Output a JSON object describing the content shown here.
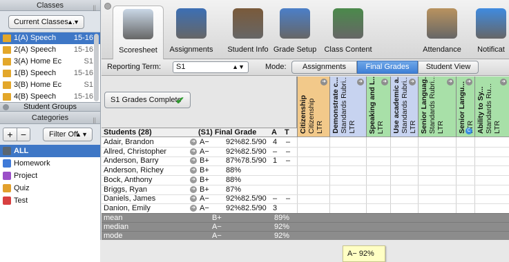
{
  "sidebar": {
    "classes_header": "Classes",
    "classes_menu": "Current Classes...",
    "classes": [
      {
        "name": "1(A) Speech",
        "term": "15-16",
        "color": "#e3a72a"
      },
      {
        "name": "2(A) Speech",
        "term": "15-16",
        "color": "#e3a72a"
      },
      {
        "name": "3(A) Home Ec",
        "term": "S1",
        "color": "#e3a72a"
      },
      {
        "name": "1(B) Speech",
        "term": "15-16",
        "color": "#e3a72a"
      },
      {
        "name": "3(B) Home Ec",
        "term": "S1",
        "color": "#e3a72a"
      },
      {
        "name": "4(B) Speech",
        "term": "15-16",
        "color": "#e3a72a"
      }
    ],
    "student_groups_header": "Student Groups",
    "categories_header": "Categories",
    "add_label": "+",
    "remove_label": "−",
    "filter_label": "Filter Off",
    "categories": [
      {
        "name": "ALL",
        "color": "#5b6670"
      },
      {
        "name": "Homework",
        "color": "#3f7ad8"
      },
      {
        "name": "Project",
        "color": "#9b4fc8"
      },
      {
        "name": "Quiz",
        "color": "#e2a02c"
      },
      {
        "name": "Test",
        "color": "#d84040"
      }
    ]
  },
  "toolbar": {
    "tabs": [
      {
        "label": "Scoresheet",
        "icon": "scoresheet-icon",
        "color": "#c9d7e6"
      },
      {
        "label": "Assignments",
        "icon": "assignments-icon",
        "color": "#3c6fb4"
      },
      {
        "label": "Student Info",
        "icon": "student-info-icon",
        "color": "#7a5a3a"
      },
      {
        "label": "Grade Setup",
        "icon": "grade-setup-icon",
        "color": "#4b7fc8"
      },
      {
        "label": "Class Content",
        "icon": "class-content-icon",
        "color": "#4b8a4b"
      },
      {
        "label": "Attendance",
        "icon": "attendance-icon",
        "color": "#b9935f"
      },
      {
        "label": "Notificat",
        "icon": "notifications-icon",
        "color": "#3f8be0"
      }
    ]
  },
  "controls": {
    "reporting_term_label": "Reporting Term:",
    "reporting_term_value": "S1",
    "mode_label": "Mode:",
    "modes": [
      "Assignments",
      "Final Grades",
      "Student View"
    ],
    "active_mode": "Final Grades"
  },
  "grid": {
    "complete_label": "S1 Grades Complete",
    "students_header": "Students (28)",
    "final_grade_header": "(S1) Final Grade",
    "a_header": "A",
    "t_header": "T",
    "assignments": [
      {
        "title": "Citizenship",
        "sub1": "Citizenship",
        "sub2": "LTR",
        "color": "#f2c98a",
        "badge": false
      },
      {
        "title": "Demonstrate c...",
        "sub1": "Standards Rubri...",
        "sub2": "LTR",
        "color": "#c7d3f0",
        "badge": false
      },
      {
        "title": "Speaking and L...",
        "sub1": "",
        "sub2": "LTR",
        "color": "#a8e0a8",
        "badge": false
      },
      {
        "title": "Use academic a...",
        "sub1": "Standards Rubri...",
        "sub2": "LTR",
        "color": "#c7d3f0",
        "badge": false
      },
      {
        "title": "Senior Languag...",
        "sub1": "Standards Rubri...",
        "sub2": "LTR",
        "color": "#a8e0a8",
        "badge": false
      },
      {
        "title": "Senior Langu...",
        "sub1": "",
        "sub2": "LTR",
        "color": "#a8e0a8",
        "badge": true
      },
      {
        "title": "Ability to Sy...",
        "sub1": "Standards Ru...",
        "sub2": "LTR",
        "color": "#a8e0a8",
        "badge": false
      }
    ],
    "students": [
      {
        "name": "Adair, Brandon",
        "letter": "A−",
        "pct": "92%",
        "pts": "82.5/90",
        "a": "4",
        "t": "–"
      },
      {
        "name": "Allred, Christopher",
        "letter": "A−",
        "pct": "92%",
        "pts": "82.5/90",
        "a": "–",
        "t": "–"
      },
      {
        "name": "Anderson, Barry",
        "letter": "B+",
        "pct": "87%",
        "pts": "78.5/90",
        "a": "1",
        "t": "–"
      },
      {
        "name": "Anderson, Richey",
        "letter": "B+",
        "pct": "88%",
        "pts": "",
        "a": "",
        "t": ""
      },
      {
        "name": "Bock, Anthony",
        "letter": "B+",
        "pct": "88%",
        "pts": "",
        "a": "",
        "t": ""
      },
      {
        "name": "Briggs, Ryan",
        "letter": "B+",
        "pct": "87%",
        "pts": "",
        "a": "",
        "t": ""
      },
      {
        "name": "Daniels, James",
        "letter": "A−",
        "pct": "92%",
        "pts": "82.5/90",
        "a": "–",
        "t": "–"
      },
      {
        "name": "Danion, Emily",
        "letter": "A−",
        "pct": "92%",
        "pts": "82.5/90",
        "a": "3",
        "t": ""
      }
    ],
    "stats": [
      {
        "label": "mean",
        "letter": "B+",
        "pct": "89%"
      },
      {
        "label": "median",
        "letter": "A−",
        "pct": "92%"
      },
      {
        "label": "mode",
        "letter": "A−",
        "pct": "92%"
      }
    ],
    "tooltip": "A− 92%"
  }
}
